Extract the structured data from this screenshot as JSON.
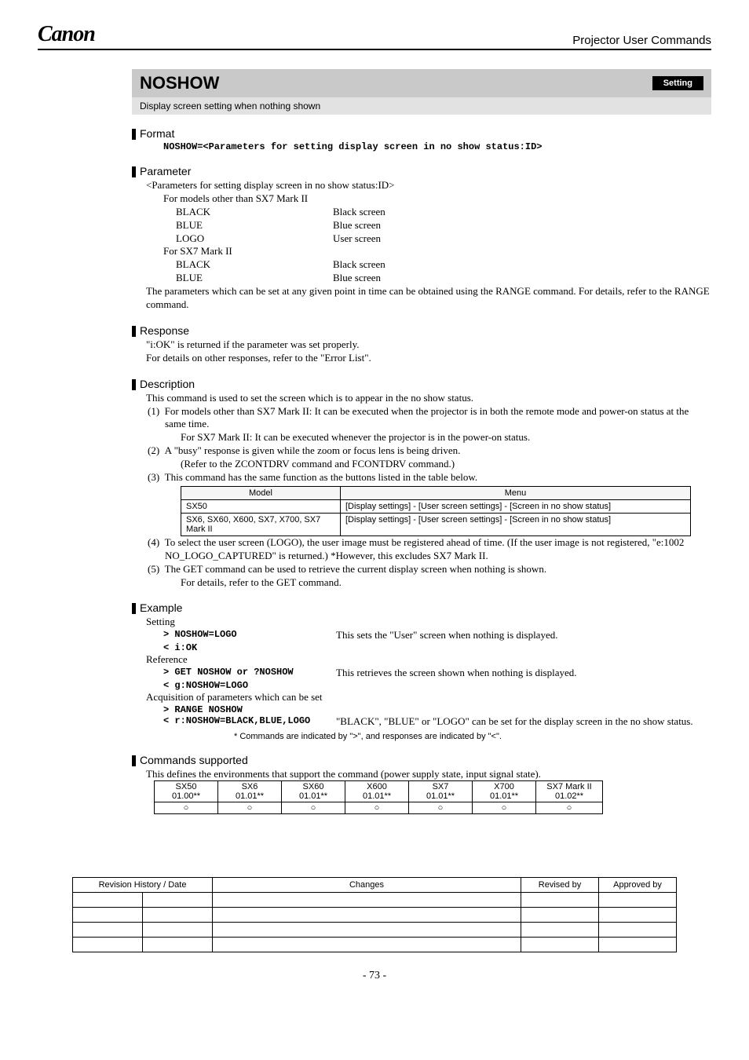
{
  "header": {
    "logo": "Canon",
    "right": "Projector User Commands"
  },
  "cmd": {
    "name": "NOSHOW",
    "badge": "Setting",
    "desc": "Display screen setting when nothing shown"
  },
  "format": {
    "title": "Format",
    "line": "NOSHOW=<Parameters for setting display screen in no show status:ID>"
  },
  "parameter": {
    "title": "Parameter",
    "intro": "<Parameters for setting display screen in no show status:ID>",
    "groupA_title": "For models other than SX7 Mark II",
    "groupA": [
      {
        "k": "BLACK",
        "v": "Black screen"
      },
      {
        "k": "BLUE",
        "v": "Blue screen"
      },
      {
        "k": "LOGO",
        "v": "User screen"
      }
    ],
    "groupB_title": "For SX7 Mark II",
    "groupB": [
      {
        "k": "BLACK",
        "v": "Black screen"
      },
      {
        "k": "BLUE",
        "v": "Blue screen"
      }
    ],
    "note": "The parameters which can be set at any given point in time can be obtained using the RANGE command. For details, refer to the RANGE command."
  },
  "response": {
    "title": "Response",
    "l1": "\"i:OK\" is returned if the parameter was set properly.",
    "l2": "For details on other responses, refer to the \"Error List\"."
  },
  "description": {
    "title": "Description",
    "intro": "This command is used to set the screen which is to appear in the no show status.",
    "i1a": "For models other than SX7 Mark II: It can be executed when the projector is in both the remote mode and power-on status at the same time.",
    "i1b": "For SX7 Mark II: It can be executed whenever the projector is in the power-on status.",
    "i2a": "A \"busy\" response is given while the zoom or focus lens is being driven.",
    "i2b": "(Refer to the ZCONTDRV command and FCONTDRV command.)",
    "i3": "This command has the same function as the buttons listed in the table below.",
    "tbl": {
      "h1": "Model",
      "h2": "Menu",
      "rows": [
        {
          "m": "SX50",
          "menu": "[Display settings] - [User screen settings] - [Screen in no show status]"
        },
        {
          "m": "SX6, SX60, X600, SX7, X700, SX7 Mark II",
          "menu": "[Display settings] - [User screen settings] - [Screen in no show status]"
        }
      ]
    },
    "i4": "To select the user screen (LOGO), the user image must be registered ahead of time. (If the  user image is not registered, \"e:1002 NO_LOGO_CAPTURED\" is returned.) *However, this excludes SX7 Mark II.",
    "i5a": "The GET command can be used to retrieve the current display screen when nothing is shown.",
    "i5b": "For details, refer to the GET command."
  },
  "example": {
    "title": "Example",
    "setting_lbl": "Setting",
    "set_cmd": "> NOSHOW=LOGO",
    "set_exp": "This sets the \"User\" screen when nothing is displayed.",
    "set_resp": "< i:OK",
    "ref_lbl": "Reference",
    "ref_cmd": "> GET NOSHOW or ?NOSHOW",
    "ref_exp": "This retrieves the screen shown when nothing is displayed.",
    "ref_resp": "< g:NOSHOW=LOGO",
    "acq_lbl": "Acquisition of parameters which can be set",
    "acq_cmd": "> RANGE NOSHOW",
    "acq_resp": "< r:NOSHOW=BLACK,BLUE,LOGO",
    "acq_exp": "\"BLACK\", \"BLUE\" or \"LOGO\" can be set for the display screen in the no show status.",
    "note": "*  Commands are indicated by \">\", and responses are indicated by \"<\"."
  },
  "commands_supported": {
    "title": "Commands supported",
    "intro": "This defines the environments that support the command (power supply state, input signal state).",
    "cols": [
      {
        "a": "SX50",
        "b": "01.00**"
      },
      {
        "a": "SX6",
        "b": "01.01**"
      },
      {
        "a": "SX60",
        "b": "01.01**"
      },
      {
        "a": "X600",
        "b": "01.01**"
      },
      {
        "a": "SX7",
        "b": "01.01**"
      },
      {
        "a": "X700",
        "b": "01.01**"
      },
      {
        "a": "SX7 Mark II",
        "b": "01.02**"
      }
    ],
    "row": [
      "○",
      "○",
      "○",
      "○",
      "○",
      "○",
      "○"
    ]
  },
  "revision": {
    "h1": "Revision History / Date",
    "h2": "Changes",
    "h3": "Revised by",
    "h4": "Approved by"
  },
  "footer": "- 73 -"
}
